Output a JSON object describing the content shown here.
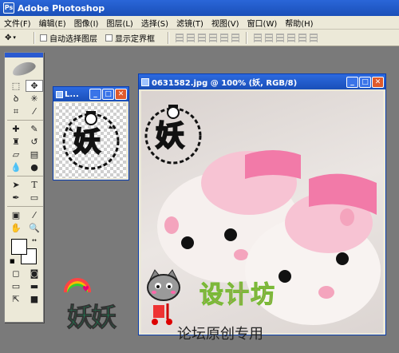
{
  "app": {
    "title": "Adobe Photoshop",
    "icon_text": "Ps"
  },
  "menu": [
    "文件(F)",
    "编辑(E)",
    "图像(I)",
    "图层(L)",
    "选择(S)",
    "滤镜(T)",
    "视图(V)",
    "窗口(W)",
    "帮助(H)"
  ],
  "options": {
    "auto_select_label": "自动选择图层",
    "show_bbox_label": "显示定界框"
  },
  "thumb_window": {
    "title": "L..."
  },
  "doc_window": {
    "title": "0631582.jpg @ 100% (妖, RGB/8)"
  },
  "stamp": {
    "char": "妖"
  },
  "watermark": {
    "name": "妖妖",
    "design": "设计坊",
    "forum": "论坛原创专用"
  },
  "colors": {
    "titlebar": "#1a4fb8",
    "workspace": "#7a7a7a",
    "panel": "#ece9d8",
    "stamp_text": "#22a6e0",
    "slipper_pink": "#f27aa8"
  }
}
